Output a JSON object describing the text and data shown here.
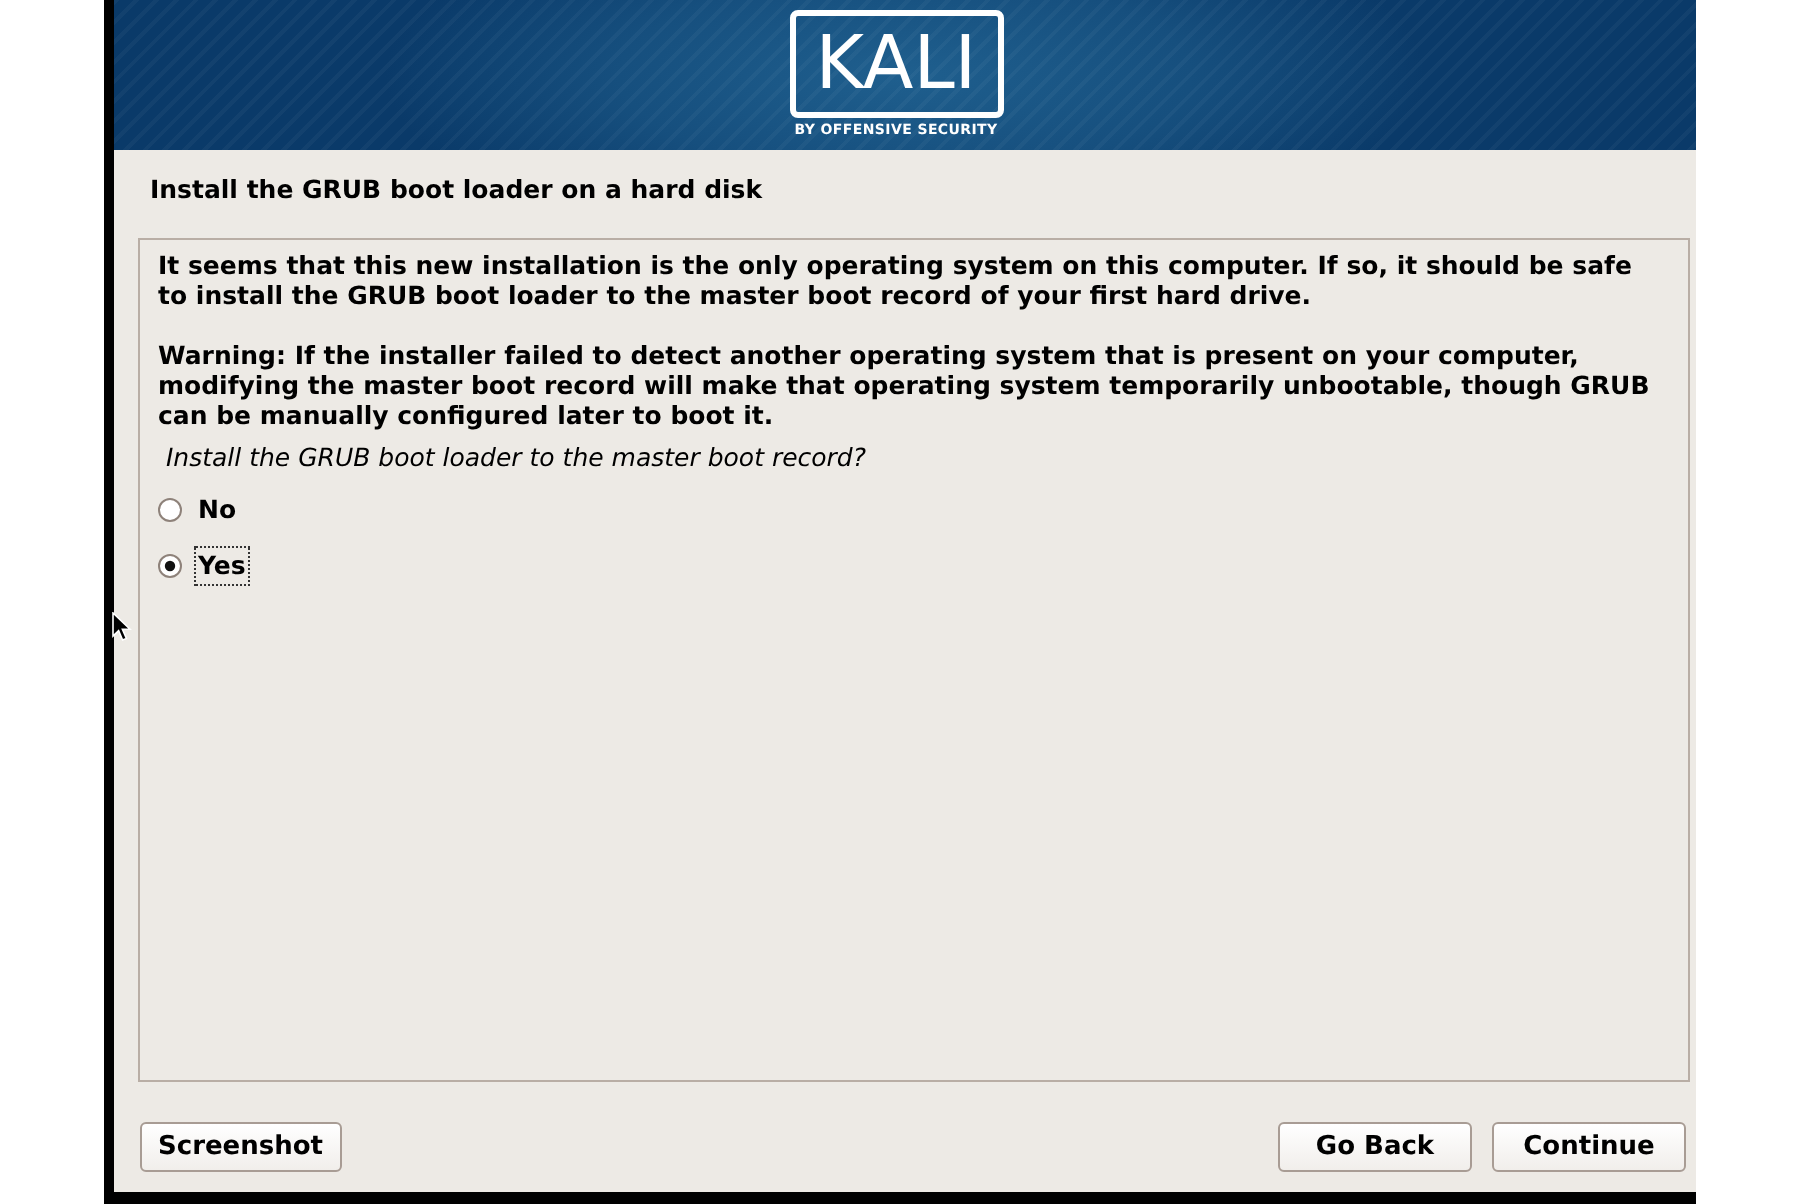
{
  "header": {
    "logo": "KALI",
    "tagline": "BY OFFENSIVE SECURITY"
  },
  "page_title": "Install the GRUB boot loader on a hard disk",
  "panel": {
    "paragraphs": [
      "It seems that this new installation is the only operating system on this computer. If so, it should be safe to install the GRUB boot loader to the master boot record of your first hard drive.",
      "Warning: If the installer failed to detect another operating system that is present on your computer, modifying the master boot record will make that operating system temporarily unbootable, though GRUB can be manually configured later to boot it."
    ],
    "question": "Install the GRUB boot loader to the master boot record?",
    "options": [
      {
        "label": "No",
        "selected": false,
        "focused": false
      },
      {
        "label": "Yes",
        "selected": true,
        "focused": true
      }
    ]
  },
  "buttons": {
    "left": [
      {
        "label": "Screenshot"
      }
    ],
    "right": [
      {
        "label": "Go Back"
      },
      {
        "label": "Continue"
      }
    ]
  }
}
